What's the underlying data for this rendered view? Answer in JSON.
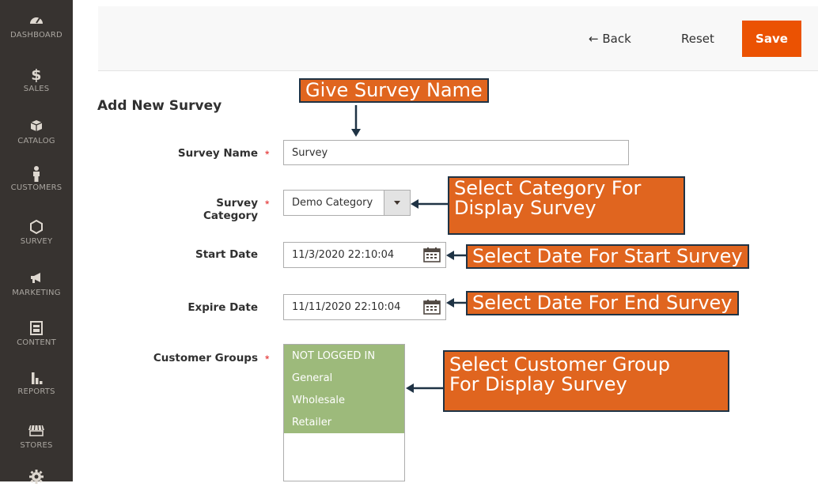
{
  "sidebar": {
    "items": [
      {
        "label": "DASHBOARD",
        "icon": "dashboard-icon"
      },
      {
        "label": "SALES",
        "icon": "dollar-icon"
      },
      {
        "label": "CATALOG",
        "icon": "box-icon"
      },
      {
        "label": "CUSTOMERS",
        "icon": "person-icon"
      },
      {
        "label": "SURVEY",
        "icon": "hexagon-icon"
      },
      {
        "label": "MARKETING",
        "icon": "megaphone-icon"
      },
      {
        "label": "CONTENT",
        "icon": "layout-icon"
      },
      {
        "label": "REPORTS",
        "icon": "bar-chart-icon"
      },
      {
        "label": "STORES",
        "icon": "storefront-icon"
      }
    ]
  },
  "header": {
    "back_label": "← Back",
    "reset_label": "Reset",
    "save_label": "Save"
  },
  "page_title": "Add New Survey",
  "form": {
    "survey_name": {
      "label": "Survey Name",
      "value": "Survey",
      "required": true
    },
    "survey_category": {
      "label": "Survey Category",
      "value": "Demo Category",
      "required": true
    },
    "start_date": {
      "label": "Start Date",
      "value": "11/3/2020 22:10:04"
    },
    "expire_date": {
      "label": "Expire Date",
      "value": "11/11/2020 22:10:04"
    },
    "customer_groups": {
      "label": "Customer Groups",
      "required": true,
      "options": [
        "NOT LOGGED IN",
        "General",
        "Wholesale",
        "Retailer"
      ]
    },
    "required_mark": "*"
  },
  "callouts": {
    "name": "Give Survey Name",
    "category_1": "Select Category For",
    "category_2": "Display Survey",
    "start": "Select Date For Start Survey",
    "end": "Select Date For End Survey",
    "groups_1": "Select Customer Group",
    "groups_2": "For Display Survey"
  },
  "colors": {
    "sidebar_bg": "#373330",
    "save_button": "#eb5202",
    "callout_fill": "#e0651f",
    "callout_border": "#1f3345",
    "selected_option": "#9dba7b",
    "required_star": "#e22626"
  }
}
